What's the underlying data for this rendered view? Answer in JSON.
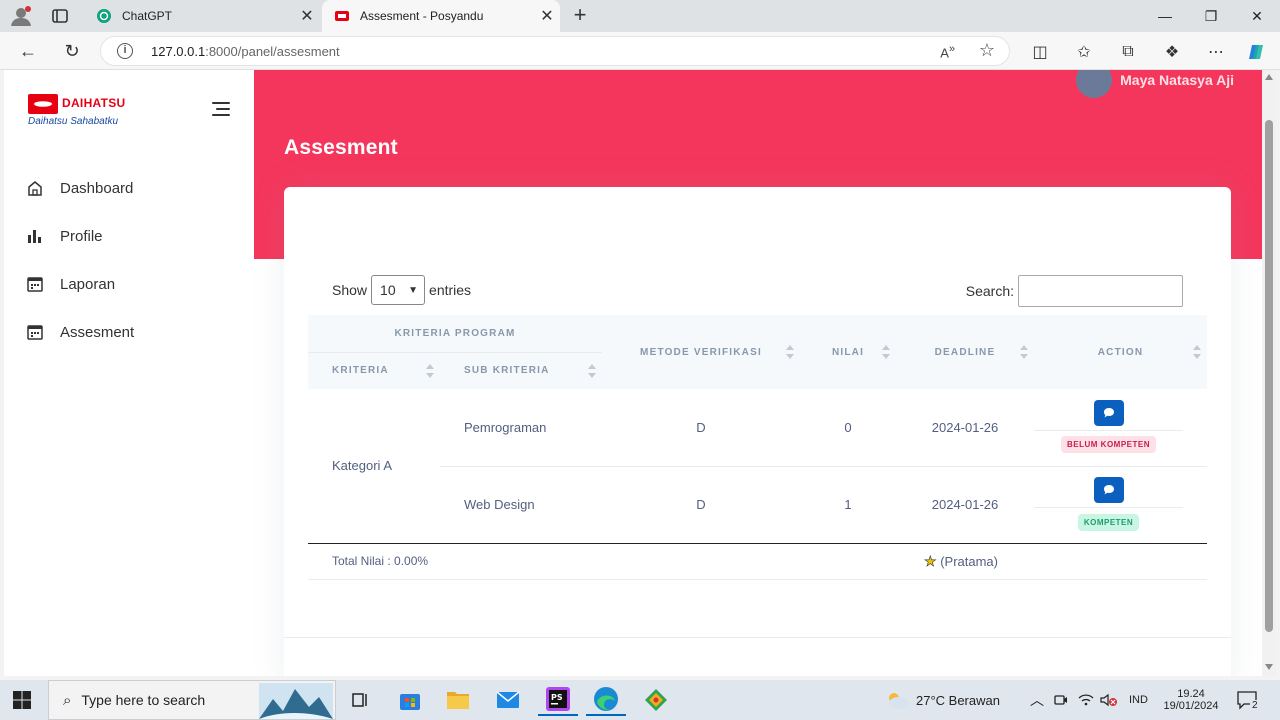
{
  "browser": {
    "tabs": [
      {
        "title": "ChatGPT",
        "active": false
      },
      {
        "title": "Assesment - Posyandu",
        "active": true
      }
    ],
    "address": {
      "host": "127.0.0.1",
      "path": ":8000/panel/assesment"
    }
  },
  "sidebar": {
    "brand": "DAIHATSU",
    "tagline": "Daihatsu Sahabatku",
    "items": [
      {
        "label": "Dashboard",
        "icon": "home-icon"
      },
      {
        "label": "Profile",
        "icon": "bar-chart-icon"
      },
      {
        "label": "Laporan",
        "icon": "calendar-icon"
      },
      {
        "label": "Assesment",
        "icon": "calendar-icon"
      }
    ]
  },
  "header": {
    "user_name": "Maya Natasya Aji",
    "page_title": "Assesment"
  },
  "table_controls": {
    "show_label": "Show",
    "entries_value": "10",
    "entries_label": "entries",
    "search_label": "Search:"
  },
  "table": {
    "group_header": "Kriteria Program",
    "headers": {
      "kriteria": "Kriteria",
      "sub_kriteria": "Sub Kriteria",
      "metode": "Metode Verifikasi",
      "nilai": "Nilai",
      "deadline": "Deadline",
      "action": "Action"
    },
    "kriteria": "Kategori A",
    "rows": [
      {
        "sub_kriteria": "Pemrograman",
        "metode": "D",
        "nilai": "0",
        "deadline": "2024-01-26",
        "status": "BELUM KOMPETEN"
      },
      {
        "sub_kriteria": "Web Design",
        "metode": "D",
        "nilai": "1",
        "deadline": "2024-01-26",
        "status": "KOMPETEN"
      }
    ],
    "footer": {
      "total": "Total Nilai : 0.00%",
      "rank": "(Pratama)"
    }
  },
  "taskbar": {
    "search_placeholder": "Type here to search",
    "weather": "27°C  Berawan",
    "language": "IND",
    "time": "19.24",
    "date": "19/01/2024",
    "notifications": "2"
  },
  "colors": {
    "accent": "#f5365c",
    "primary": "#0b5fbf",
    "success_bg": "#c9f5e4",
    "danger_bg": "#fde1e7"
  }
}
